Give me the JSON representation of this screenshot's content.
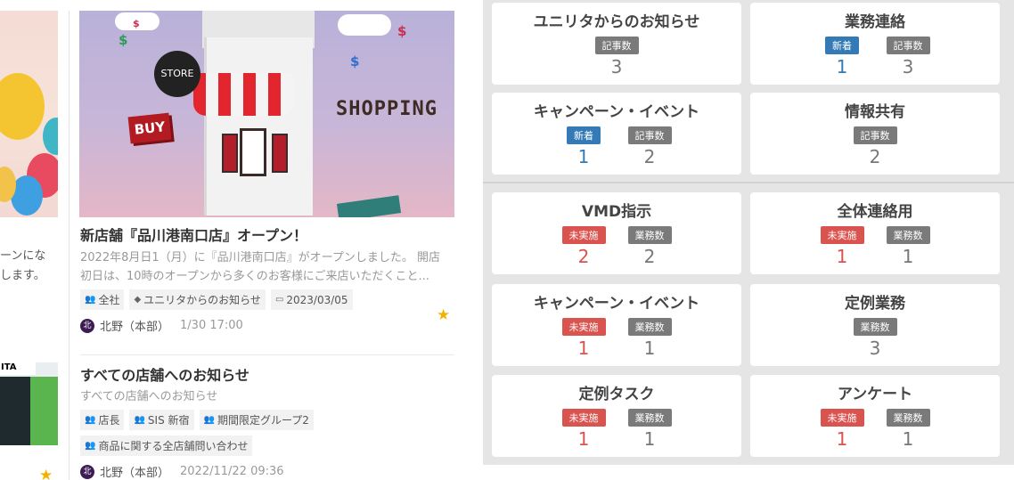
{
  "left": {
    "partial_card": {
      "text_line1": "ーンにな",
      "text_line2": "します。",
      "magazine_label": "ITA"
    },
    "article1": {
      "image": {
        "store_sign": "STORE",
        "buy_sign": "BUY",
        "shopping": "SHOPPING"
      },
      "title": "新店舗『品川港南口店』オープン！",
      "desc_line1": "2022年8月日1（月）に『品川港南口店』がオープンしました。 開店",
      "desc_line2": "初日は、10時のオープンから多くのお客様にご来店いただくこと...",
      "tags": [
        {
          "icon": "group-icon",
          "label": "全社"
        },
        {
          "icon": "tag-icon",
          "label": "ユニリタからのお知らせ"
        },
        {
          "icon": "calendar-icon",
          "label": "2023/03/05"
        }
      ],
      "author_initial": "北",
      "author": "北野（本部）",
      "datetime": "1/30 17:00",
      "favorited": true
    },
    "article2": {
      "title": "すべての店舗へのお知らせ",
      "desc": "すべての店舗へのお知らせ",
      "tags_row1": [
        {
          "icon": "group-icon",
          "label": "店長"
        },
        {
          "icon": "group-icon",
          "label": "SIS 新宿"
        },
        {
          "icon": "group-icon",
          "label": "期間限定グループ2"
        }
      ],
      "tags_row2": [
        {
          "icon": "group-icon",
          "label": "商品に関する全店舗問い合わせ"
        }
      ],
      "author_initial": "北",
      "author": "北野（本部）",
      "datetime": "2022/11/22 09:36"
    }
  },
  "dashboard": {
    "colors": {
      "new": "#337ab7",
      "count": "#7a7a7a",
      "undone": "#d9534f"
    },
    "panels": [
      {
        "title": "ユニリタからのお知らせ",
        "items": [
          {
            "badge": "記事数",
            "type": "count",
            "value": "3"
          }
        ]
      },
      {
        "title": "業務連絡",
        "items": [
          {
            "badge": "新着",
            "type": "new",
            "value": "1"
          },
          {
            "badge": "記事数",
            "type": "count",
            "value": "3"
          }
        ]
      },
      {
        "title": "キャンペーン・イベント",
        "items": [
          {
            "badge": "新着",
            "type": "new",
            "value": "1"
          },
          {
            "badge": "記事数",
            "type": "count",
            "value": "2"
          }
        ]
      },
      {
        "title": "情報共有",
        "items": [
          {
            "badge": "記事数",
            "type": "count",
            "value": "2"
          }
        ]
      },
      {
        "title": "VMD指示",
        "items": [
          {
            "badge": "未実施",
            "type": "undone",
            "value": "2"
          },
          {
            "badge": "業務数",
            "type": "count",
            "value": "2"
          }
        ]
      },
      {
        "title": "全体連絡用",
        "items": [
          {
            "badge": "未実施",
            "type": "undone",
            "value": "1"
          },
          {
            "badge": "業務数",
            "type": "count",
            "value": "1"
          }
        ]
      },
      {
        "title": "キャンペーン・イベント",
        "items": [
          {
            "badge": "未実施",
            "type": "undone",
            "value": "1"
          },
          {
            "badge": "業務数",
            "type": "count",
            "value": "1"
          }
        ]
      },
      {
        "title": "定例業務",
        "items": [
          {
            "badge": "業務数",
            "type": "count",
            "value": "3"
          }
        ]
      },
      {
        "title": "定例タスク",
        "items": [
          {
            "badge": "未実施",
            "type": "undone",
            "value": "1"
          },
          {
            "badge": "業務数",
            "type": "count",
            "value": "1"
          }
        ]
      },
      {
        "title": "アンケート",
        "items": [
          {
            "badge": "未実施",
            "type": "undone",
            "value": "1"
          },
          {
            "badge": "業務数",
            "type": "count",
            "value": "1"
          }
        ]
      }
    ]
  }
}
